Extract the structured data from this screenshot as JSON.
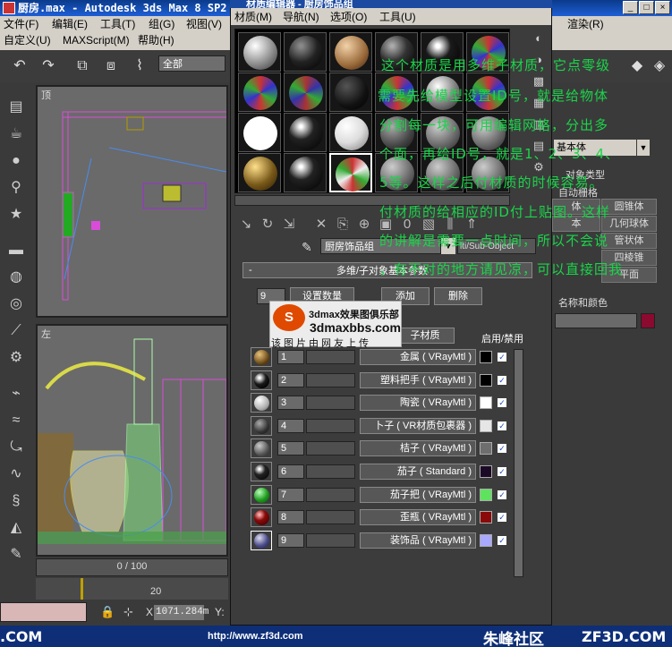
{
  "app": {
    "title": "厨房.max - Autodesk 3ds Max 8 SP2",
    "menu_row1": [
      "文件(F)",
      "编辑(E)",
      "工具(T)",
      "组(G)",
      "视图(V)"
    ],
    "menu_row1_right": [
      "渲染(R)"
    ],
    "menu_row2": [
      "自定义(U)",
      "MAXScript(M)",
      "帮助(H)"
    ],
    "selection_filter": "全部",
    "win_buttons": [
      "_",
      "□",
      "×"
    ]
  },
  "viewports": {
    "top_label": "顶",
    "left_label": "左"
  },
  "timeline": {
    "frame_text": "0 / 100",
    "track_tick": "20"
  },
  "status": {
    "x_label": "X:",
    "x_value": "1071.284m",
    "y_label": "Y:"
  },
  "right_panel": {
    "primitive_dropdown": "基本体",
    "rollout_object_type": "对象类型",
    "autogrid": "自动栅格",
    "buttons": [
      "体",
      "圆锥体",
      "本",
      "几何球体",
      "管状体",
      "四棱锥",
      "平面"
    ],
    "name_color": "名称和颜色",
    "name_color_swatch": "#8b0a30"
  },
  "material_editor": {
    "title": "材质编辑器 - 厨房饰品组",
    "menu": [
      "材质(M)",
      "导航(N)",
      "选项(O)",
      "工具(U)"
    ],
    "material_name": "厨房饰品组",
    "material_type": "lti/Sub-Object",
    "rollout_title": "多维/子对象基本参数",
    "count": "9",
    "set_count": "设置数量",
    "add": "添加",
    "delete": "删除",
    "column_material": "子材质",
    "column_enable": "启用/禁用",
    "rows": [
      {
        "id": "1",
        "name": "金属 ( VRayMtl )",
        "swatch": "#000000",
        "sphere": "radial-gradient(circle at 35% 30%,#e8c27a,#5a3b0c 70%)"
      },
      {
        "id": "2",
        "name": "塑料把手 ( VRayMtl )",
        "swatch": "#000000",
        "sphere": "radial-gradient(circle at 35% 30%,#fff 5%,#1a1a1a 45%,#000 80%)"
      },
      {
        "id": "3",
        "name": "陶瓷 ( VRayMtl )",
        "swatch": "#ffffff",
        "sphere": "radial-gradient(circle at 35% 30%,#fff,#b0b0b0 60%,#555)"
      },
      {
        "id": "4",
        "name": "卜子 ( VR材质包裹器 )",
        "swatch": "#e6e6e6",
        "sphere": "radial-gradient(circle at 35% 30%,#aaa,#333 60%,#111)"
      },
      {
        "id": "5",
        "name": "桔子 ( VRayMtl )",
        "swatch": "#6e6e6e",
        "sphere": "radial-gradient(circle at 35% 30%,#ccc,#555 60%,#222)"
      },
      {
        "id": "6",
        "name": "茄子 ( Standard )",
        "swatch": "#1a0a26",
        "sphere": "radial-gradient(circle at 35% 30%,#fff 4%,#222 40%,#000)"
      },
      {
        "id": "7",
        "name": "茄子把 ( VRayMtl )",
        "swatch": "#5ee35e",
        "sphere": "radial-gradient(circle at 35% 30%,#b9ffb9,#1d9a1d 55%,#0b4a0b)"
      },
      {
        "id": "8",
        "name": "歪瓶 ( VRayMtl )",
        "swatch": "#8a0a0a",
        "sphere": "radial-gradient(circle at 35% 30%,#ffb0b0 4%,#8a0a0a 40%,#300)"
      },
      {
        "id": "9",
        "name": "装饰品 ( VRayMtl )",
        "swatch": "#a8a8ff",
        "sphere": "radial-gradient(circle at 35% 30%,#dde,#4a4a8a 55%,#1a1a3a)"
      }
    ]
  },
  "watermark": {
    "line1": "3dmax效果图俱乐部",
    "line2": "3dmaxbbs.com",
    "line3": "该图片由网友上传",
    "mark": "S"
  },
  "overlay_text": [
    "这个材质是用多维子材质，它点零级",
    "需要先给模型设置ID号，就是给物体",
    "分割每一块，可用编辑网格，分出多",
    "个面，再给ID号，就是1、2、3、4、",
    "5等。这样之后付材质的时候容易。",
    "付材质的给相应的ID付上贴图。这样",
    "的讲解是需要一点时间，所以不会说",
    "，有不对的地方请见凉，可以直接回我"
  ],
  "footer": {
    "left": ".COM",
    "url": "http://www.zf3d.com",
    "center": "朱峰社区",
    "right": "ZF3D.COM"
  }
}
